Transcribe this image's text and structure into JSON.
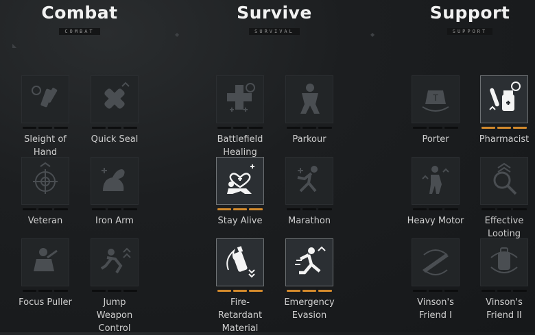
{
  "columns": [
    {
      "title": "Combat",
      "subtitle": "COMBAT"
    },
    {
      "title": "Survive",
      "subtitle": "SURVIVAL"
    },
    {
      "title": "Support",
      "subtitle": "SUPPORT"
    }
  ],
  "skills": [
    {
      "name": "Sleight of Hand",
      "icon": "sleight-of-hand-icon",
      "level": 0,
      "max": 3
    },
    {
      "name": "Quick Seal",
      "icon": "bandage-icon",
      "level": 0,
      "max": 3
    },
    {
      "name": "Veteran",
      "icon": "crosshair-icon",
      "level": 0,
      "max": 3
    },
    {
      "name": "Iron Arm",
      "icon": "flexed-arm-icon",
      "level": 0,
      "max": 3
    },
    {
      "name": "Focus Puller",
      "icon": "soldier-aiming-icon",
      "level": 0,
      "max": 3
    },
    {
      "name": "Jump Weapon Control",
      "icon": "jumping-soldier-icon",
      "level": 0,
      "max": 3
    },
    {
      "name": "Battlefield Healing",
      "icon": "medkit-timer-icon",
      "level": 0,
      "max": 3
    },
    {
      "name": "Parkour",
      "icon": "climbing-soldier-icon",
      "level": 0,
      "max": 3
    },
    {
      "name": "Stay Alive",
      "icon": "heart-soldier-icon",
      "level": 3,
      "max": 3
    },
    {
      "name": "Marathon",
      "icon": "running-soldier-icon",
      "level": 0,
      "max": 3
    },
    {
      "name": "Fire-Retardant Material",
      "icon": "fire-bottle-icon",
      "level": 3,
      "max": 3
    },
    {
      "name": "Emergency Evasion",
      "icon": "evading-runner-icon",
      "level": 3,
      "max": 3
    },
    {
      "name": "Porter",
      "icon": "weight-carry-icon",
      "level": 0,
      "max": 3
    },
    {
      "name": "Pharmacist",
      "icon": "pills-bottle-timer-icon",
      "level": 3,
      "max": 3
    },
    {
      "name": "Heavy Motor",
      "icon": "soldier-gear-icon",
      "level": 0,
      "max": 3
    },
    {
      "name": "Effective Looting",
      "icon": "magnifier-icon",
      "level": 0,
      "max": 3
    },
    {
      "name": "Vinson's Friend I",
      "icon": "rifle-swap-icon",
      "level": 0,
      "max": 3
    },
    {
      "name": "Vinson's Friend II",
      "icon": "backpack-swap-icon",
      "level": 0,
      "max": 3
    }
  ],
  "colors": {
    "accent": "#d38a2c",
    "tile": "#222527",
    "background": "#1c1e20"
  }
}
